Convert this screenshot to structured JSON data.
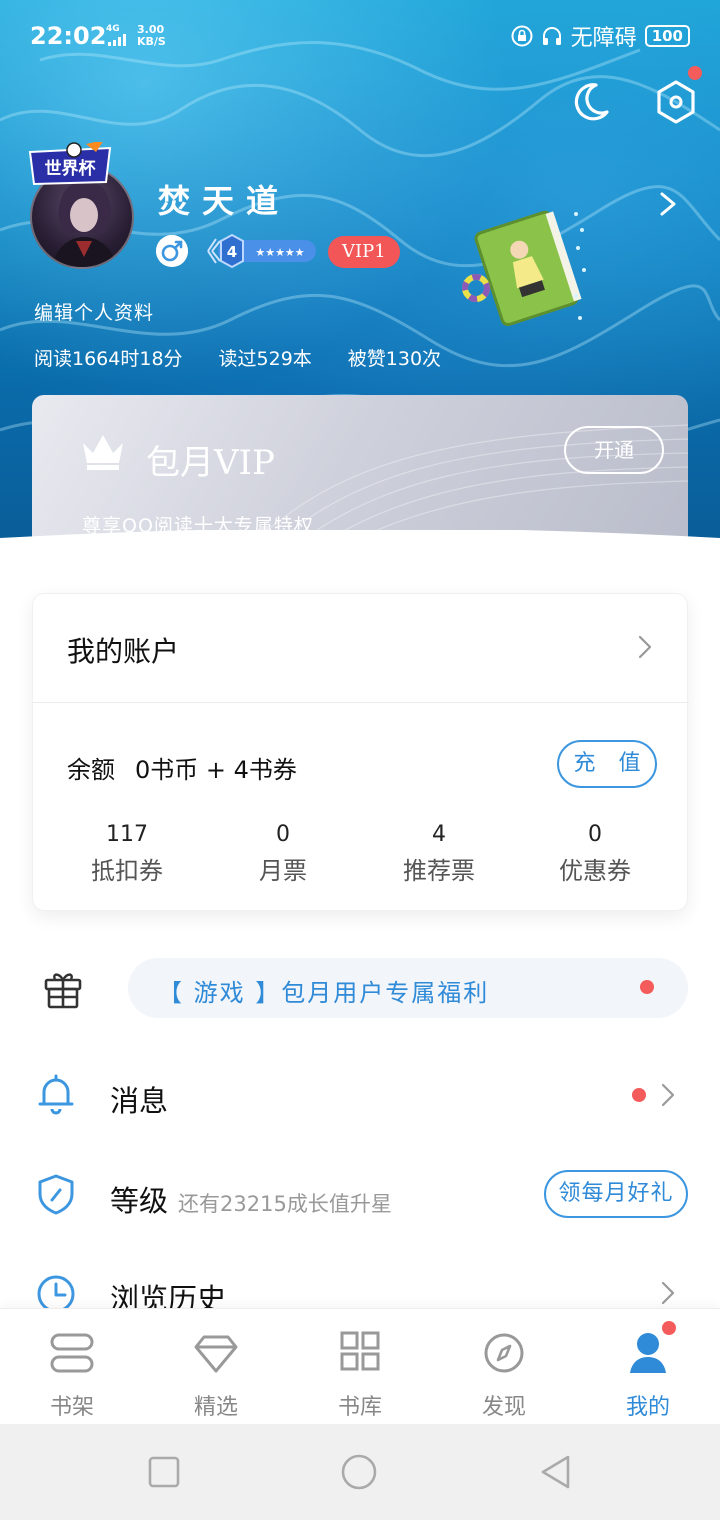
{
  "status_bar": {
    "time": "22:02",
    "network": "4G",
    "speed_top": "3.00",
    "speed_unit": "KB/S",
    "accessibility": "无障碍",
    "battery": "100"
  },
  "profile": {
    "avatar_badge": "世界杯",
    "username": "焚天道",
    "level": "4",
    "vip_tag": "VIP1",
    "edit_label": "编辑个人资料",
    "stats": [
      "阅读1664时18分",
      "读过529本",
      "被赞130次"
    ]
  },
  "vip_card": {
    "title": "包月VIP",
    "open_label": "开通",
    "description": "尊享QQ阅读十大专属特权"
  },
  "account": {
    "title": "我的账户",
    "balance_label": "余额",
    "balance_value": "0书币 + 4书券",
    "recharge_label": "充 值",
    "stats": [
      {
        "value": "117",
        "label": "抵扣券"
      },
      {
        "value": "0",
        "label": "月票"
      },
      {
        "value": "4",
        "label": "推荐票"
      },
      {
        "value": "0",
        "label": "优惠券"
      }
    ]
  },
  "promo": {
    "text": "【 游戏 】包月用户专属福利"
  },
  "menu": {
    "messages": "消息",
    "level": "等级",
    "level_sub": "还有23215成长值升星",
    "level_button": "领每月好礼",
    "history": "浏览历史"
  },
  "tabs": [
    {
      "label": "书架",
      "icon": "bookshelf-icon"
    },
    {
      "label": "精选",
      "icon": "diamond-icon"
    },
    {
      "label": "书库",
      "icon": "grid-icon"
    },
    {
      "label": "发现",
      "icon": "compass-icon"
    },
    {
      "label": "我的",
      "icon": "person-icon",
      "active": true
    }
  ],
  "colors": {
    "accent": "#2f8ad8",
    "vip_red": "#f25656",
    "notification_red": "#f45b5b"
  }
}
